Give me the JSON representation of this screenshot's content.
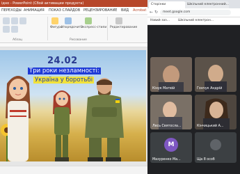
{
  "powerpoint": {
    "window_title": "ідно  -  PowerPoint (Сбой активации продукта)",
    "tabs": [
      "ПЕРЕХОДЫ",
      "АНИМАЦИЯ",
      "ПОКАЗ СЛАЙДОВ",
      "РЕЦЕНЗИРОВАНИЕ",
      "ВИД",
      "Acrobat"
    ],
    "ribbon": {
      "figures": "Фигуры",
      "arrange": "Упорядочить",
      "quick_styles": "Экспресс-стили",
      "editing": "Редактирование",
      "group_abzats": "Абзац",
      "group_draw": "Рисование"
    },
    "slide": {
      "date": "24.02",
      "line1": "Три роки незламності:",
      "line2": "Україна у боротьбі"
    }
  },
  "meet": {
    "tabs": [
      "Сторінки",
      "Шкільний електронний..."
    ],
    "address": "meet.google.com",
    "bookmarks": [
      "Новий заз...",
      "Шкільний електрон..."
    ],
    "participants": [
      {
        "name": "Кінук Матвій",
        "type": "video"
      },
      {
        "name": "Гончук Андрій",
        "type": "video"
      },
      {
        "name": "Лесь Святосла...",
        "type": "video"
      },
      {
        "name": "Кінчицький А...",
        "type": "video"
      },
      {
        "name": "Мазуренко Ма...",
        "type": "avatar",
        "initial": "М",
        "color": "#7e57c2"
      },
      {
        "name": "Ща 8 особ",
        "type": "avatar",
        "initial": "",
        "color": "#5f6368"
      }
    ]
  }
}
